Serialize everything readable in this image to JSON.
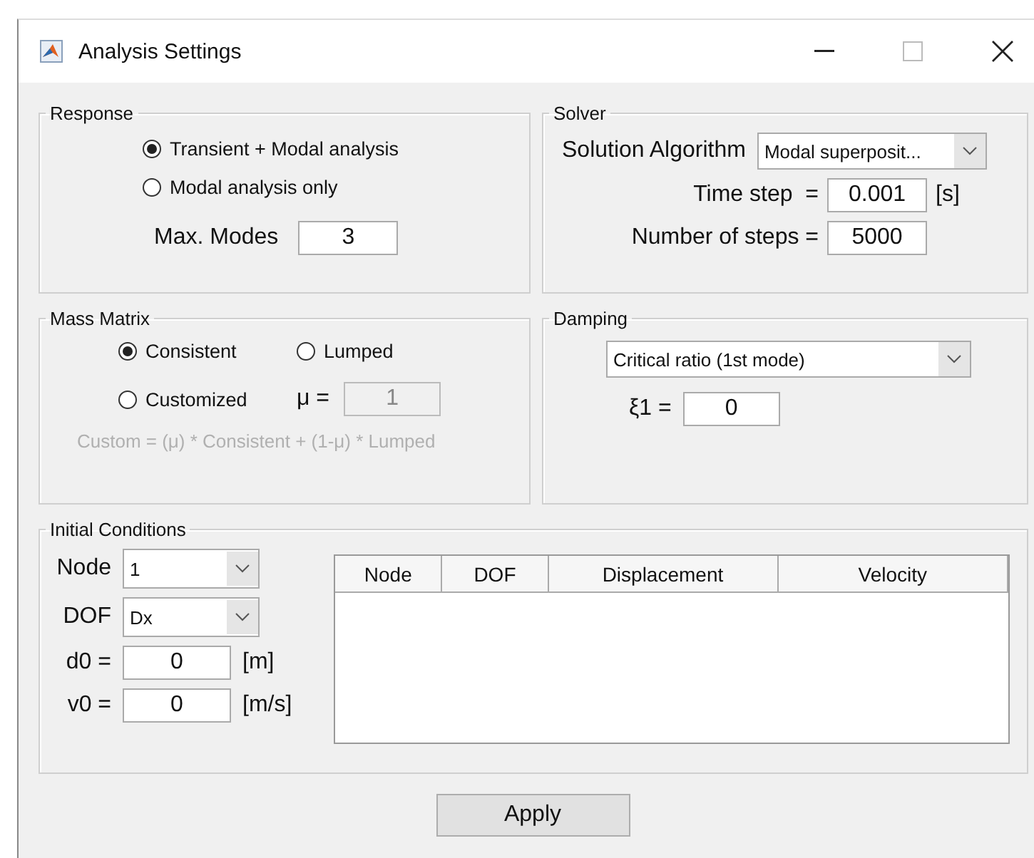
{
  "window": {
    "title": "Analysis Settings"
  },
  "response": {
    "legend": "Response",
    "options": [
      {
        "label": "Transient + Modal analysis",
        "selected": true
      },
      {
        "label": "Modal analysis only",
        "selected": false
      }
    ],
    "max_modes": {
      "label": "Max. Modes",
      "value": "3"
    }
  },
  "solver": {
    "legend": "Solver",
    "algorithm": {
      "label": "Solution Algorithm",
      "value": "Modal superposit..."
    },
    "time_step": {
      "label": "Time step  =",
      "value": "0.001",
      "unit": "[s]"
    },
    "steps": {
      "label": "Number of steps =",
      "value": "5000"
    }
  },
  "mass_matrix": {
    "legend": "Mass Matrix",
    "options": [
      {
        "label": "Consistent",
        "selected": true
      },
      {
        "label": "Lumped",
        "selected": false
      },
      {
        "label": "Customized",
        "selected": false
      }
    ],
    "mu": {
      "label": "μ =",
      "value": "1",
      "disabled": true
    },
    "formula": "Custom = (μ) * Consistent + (1-μ) * Lumped"
  },
  "damping": {
    "legend": "Damping",
    "type": {
      "value": "Critical ratio (1st mode)"
    },
    "xi": {
      "label": "ξ1 =",
      "value": "0"
    }
  },
  "initial_conditions": {
    "legend": "Initial Conditions",
    "node": {
      "label": "Node",
      "value": "1"
    },
    "dof": {
      "label": "DOF",
      "value": "Dx"
    },
    "d0": {
      "label": "d0 =",
      "value": "0",
      "unit": "[m]"
    },
    "v0": {
      "label": "v0 =",
      "value": "0",
      "unit": "[m/s]"
    },
    "table": {
      "columns": [
        "Node",
        "DOF",
        "Displacement",
        "Velocity"
      ]
    }
  },
  "apply_button": "Apply"
}
